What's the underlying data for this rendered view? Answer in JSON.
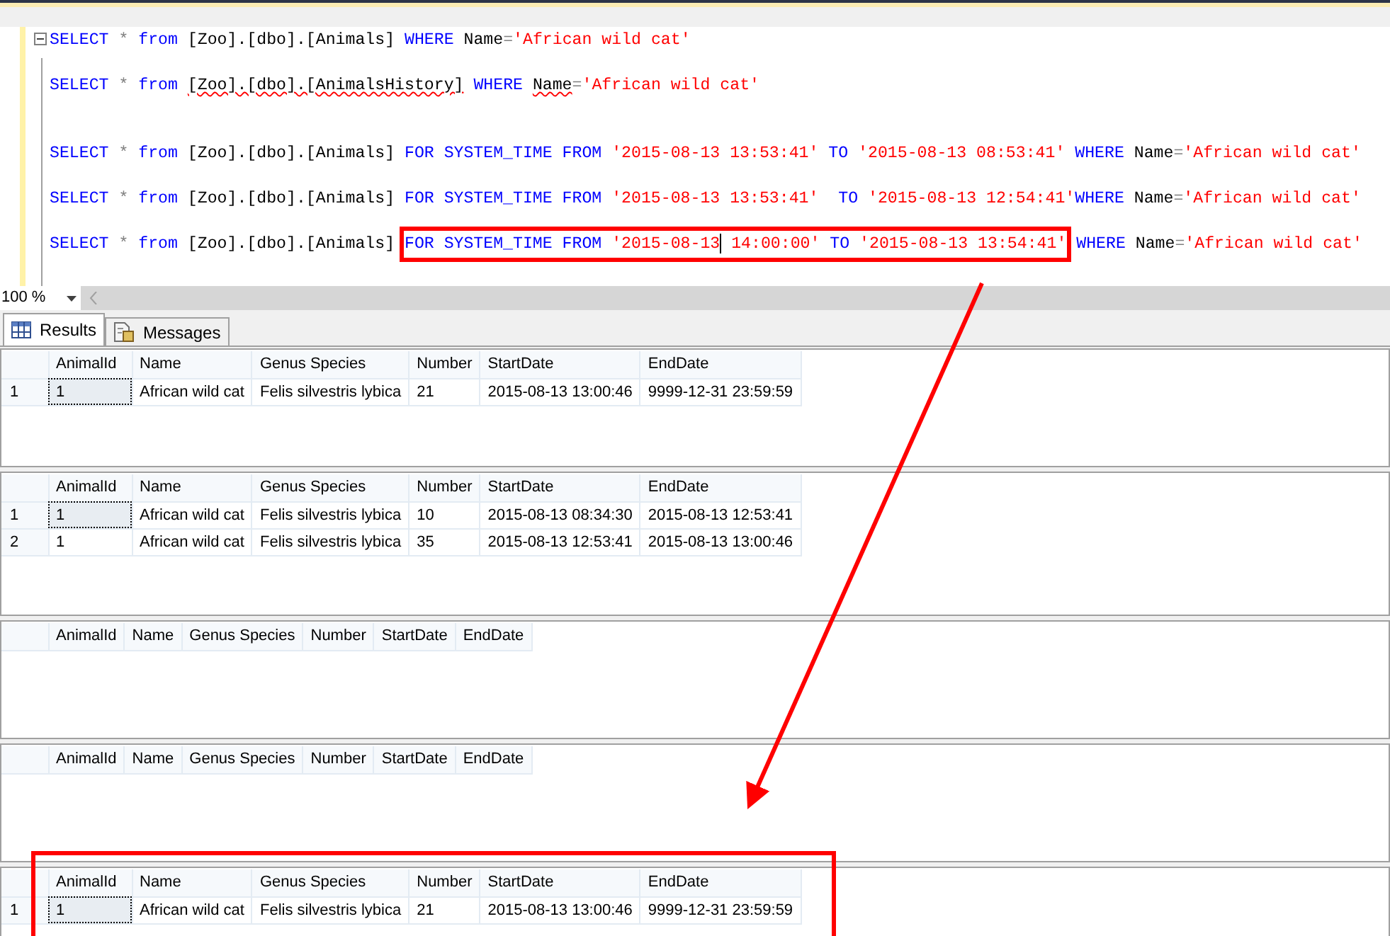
{
  "editor": {
    "lines": [
      {
        "collapsible": true,
        "tokens": [
          {
            "t": "SELECT ",
            "kind": "keyword"
          },
          {
            "t": "* ",
            "kind": "operator"
          },
          {
            "t": "from ",
            "kind": "keyword"
          },
          {
            "t": "[Zoo].[dbo].[Animals] ",
            "kind": "identifier"
          },
          {
            "t": "WHERE ",
            "kind": "keyword"
          },
          {
            "t": "Name",
            "kind": "identifier"
          },
          {
            "t": "=",
            "kind": "operator"
          },
          {
            "t": "'African wild cat'",
            "kind": "string"
          }
        ]
      },
      {
        "collapsible": false,
        "tokens": [
          {
            "t": "SELECT ",
            "kind": "keyword"
          },
          {
            "t": "* ",
            "kind": "operator"
          },
          {
            "t": "from ",
            "kind": "keyword"
          },
          {
            "t": "[Zoo].[dbo].[AnimalsHistory]",
            "kind": "identifier",
            "squiggle": true
          },
          {
            "t": " WHERE ",
            "kind": "keyword"
          },
          {
            "t": "Name",
            "kind": "identifier",
            "squiggle": true
          },
          {
            "t": "=",
            "kind": "operator"
          },
          {
            "t": "'African wild cat'",
            "kind": "string"
          }
        ]
      },
      {
        "collapsible": false,
        "tokens": [
          {
            "t": "SELECT ",
            "kind": "keyword"
          },
          {
            "t": "* ",
            "kind": "operator"
          },
          {
            "t": "from ",
            "kind": "keyword"
          },
          {
            "t": "[Zoo].[dbo].[Animals] ",
            "kind": "identifier"
          },
          {
            "t": "FOR SYSTEM_TIME FROM ",
            "kind": "keyword"
          },
          {
            "t": "'2015-08-13 13:53:41'",
            "kind": "string"
          },
          {
            "t": " TO ",
            "kind": "keyword"
          },
          {
            "t": "'2015-08-13 08:53:41'",
            "kind": "string"
          },
          {
            "t": " WHERE ",
            "kind": "keyword"
          },
          {
            "t": "Name",
            "kind": "identifier"
          },
          {
            "t": "=",
            "kind": "operator"
          },
          {
            "t": "'African wild cat'",
            "kind": "string"
          }
        ]
      },
      {
        "collapsible": false,
        "tokens": [
          {
            "t": "SELECT ",
            "kind": "keyword"
          },
          {
            "t": "* ",
            "kind": "operator"
          },
          {
            "t": "from ",
            "kind": "keyword"
          },
          {
            "t": "[Zoo].[dbo].[Animals] ",
            "kind": "identifier"
          },
          {
            "t": "FOR SYSTEM_TIME FROM ",
            "kind": "keyword"
          },
          {
            "t": "'2015-08-13 13:53:41'",
            "kind": "string"
          },
          {
            "t": "  TO ",
            "kind": "keyword"
          },
          {
            "t": "'2015-08-13 12:54:41'",
            "kind": "string"
          },
          {
            "t": "WHERE ",
            "kind": "keyword"
          },
          {
            "t": "Name",
            "kind": "identifier"
          },
          {
            "t": "=",
            "kind": "operator"
          },
          {
            "t": "'African wild cat'",
            "kind": "string"
          }
        ]
      },
      {
        "collapsible": false,
        "tokens": [
          {
            "t": "SELECT ",
            "kind": "keyword"
          },
          {
            "t": "* ",
            "kind": "operator"
          },
          {
            "t": "from ",
            "kind": "keyword"
          },
          {
            "t": "[Zoo].[dbo].[Animals] ",
            "kind": "identifier"
          },
          {
            "t": "FOR SYSTEM_TIME FROM ",
            "kind": "keyword",
            "boxed": true
          },
          {
            "t": "'2015-08-13",
            "kind": "string",
            "boxed": true
          },
          {
            "kind": "cursor"
          },
          {
            "t": " 14:00:00'",
            "kind": "string",
            "boxed": true
          },
          {
            "t": " TO ",
            "kind": "keyword",
            "boxed": true
          },
          {
            "t": "'2015-08-13 13:54:41'",
            "kind": "string",
            "boxed": true
          },
          {
            "t": " WHERE ",
            "kind": "keyword"
          },
          {
            "t": "Name",
            "kind": "identifier"
          },
          {
            "t": "=",
            "kind": "operator"
          },
          {
            "t": "'African wild cat'",
            "kind": "string"
          }
        ]
      }
    ]
  },
  "zoom": "100 %",
  "tabs": [
    {
      "label": "Results",
      "selected": true
    },
    {
      "label": "Messages",
      "selected": false
    }
  ],
  "results": [
    {
      "annotated": false,
      "columns": [
        "AnimalId",
        "Name",
        "Genus Species",
        "Number",
        "StartDate",
        "EndDate"
      ],
      "rows": [
        {
          "number": "1",
          "focused": true,
          "cells": [
            "1",
            "African wild cat",
            "Felis silvestris lybica",
            "21",
            "2015-08-13 13:00:46",
            "9999-12-31 23:59:59"
          ]
        }
      ]
    },
    {
      "annotated": false,
      "columns": [
        "AnimalId",
        "Name",
        "Genus Species",
        "Number",
        "StartDate",
        "EndDate"
      ],
      "rows": [
        {
          "number": "1",
          "focused": true,
          "cells": [
            "1",
            "African wild cat",
            "Felis silvestris lybica",
            "10",
            "2015-08-13 08:34:30",
            "2015-08-13 12:53:41"
          ]
        },
        {
          "number": "2",
          "focused": false,
          "cells": [
            "1",
            "African wild cat",
            "Felis silvestris lybica",
            "35",
            "2015-08-13 12:53:41",
            "2015-08-13 13:00:46"
          ]
        }
      ]
    },
    {
      "annotated": false,
      "columns": [
        "AnimalId",
        "Name",
        "Genus Species",
        "Number",
        "StartDate",
        "EndDate"
      ]
    },
    {
      "annotated": false,
      "columns": [
        "AnimalId",
        "Name",
        "Genus Species",
        "Number",
        "StartDate",
        "EndDate"
      ]
    },
    {
      "annotated": true,
      "columns": [
        "AnimalId",
        "Name",
        "Genus Species",
        "Number",
        "StartDate",
        "EndDate"
      ],
      "rows": [
        {
          "number": "1",
          "focused": true,
          "cells": [
            "1",
            "African wild cat",
            "Felis silvestris lybica",
            "21",
            "2015-08-13 13:00:46",
            "9999-12-31 23:59:59"
          ]
        }
      ]
    }
  ]
}
